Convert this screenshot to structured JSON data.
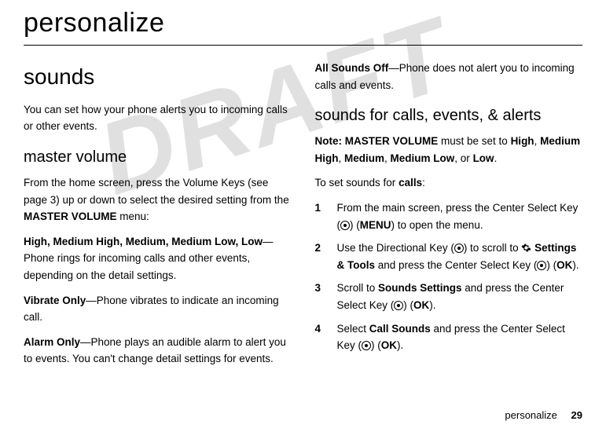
{
  "watermark": "DRAFT",
  "chapter_title": "personalize",
  "left": {
    "section_title": "sounds",
    "intro": "You can set how your phone alerts you to incoming calls or other events.",
    "sub1_title": "master volume",
    "sub1_p1_a": "From the home screen, press the Volume Keys (see page 3) up or down to select the desired setting from the ",
    "sub1_p1_b": "MASTER VOLUME",
    "sub1_p1_c": " menu:",
    "levels_list": "High, Medium High, Medium, Medium Low, Low",
    "levels_suffix": "—Phone rings for incoming calls and other events, depending on the detail settings.",
    "vibrate_label": "Vibrate Only",
    "vibrate_text": "—Phone vibrates to indicate an incoming call.",
    "alarm_label": "Alarm Only",
    "alarm_text": "—Phone plays an audible alarm to alert you to events. You can't change detail settings for events."
  },
  "right": {
    "allsounds_label": "All Sounds Off",
    "allsounds_text": "—Phone does not alert you to incoming calls and events.",
    "sub2_title": "sounds for calls, events, & alerts",
    "note_label": "Note: ",
    "note_b1": "MASTER VOLUME",
    "note_mid": " must be set to ",
    "opt_high": "High",
    "opt_medhigh": "Medium High",
    "opt_med": "Medium",
    "opt_medlow": "Medium Low",
    "opt_low": "Low",
    "note_or": ", or ",
    "note_end": ".",
    "toset_a": "To set sounds for ",
    "toset_b": "calls",
    "toset_c": ":",
    "s1_num": "1",
    "s1_a": "From the main screen, press the Center Select Key (",
    "s1_b": ") (",
    "s1_menu": "MENU",
    "s1_c": ") to open the menu.",
    "s2_num": "2",
    "s2_a": "Use the Directional Key (",
    "s2_b": ") to scroll to ",
    "s2_settings": "Settings & Tools",
    "s2_c": " and press the Center Select Key (",
    "s2_d": ") (",
    "s2_ok": "OK",
    "s2_e": ").",
    "s3_num": "3",
    "s3_a": "Scroll to ",
    "s3_sounds": "Sounds Settings",
    "s3_b": " and press the Center Select Key (",
    "s3_c": ") (",
    "s3_ok": "OK",
    "s3_d": ").",
    "s4_num": "4",
    "s4_a": "Select ",
    "s4_call": "Call Sounds",
    "s4_b": " and press the Center Select Key (",
    "s4_c": ") (",
    "s4_ok": "OK",
    "s4_d": ")."
  },
  "footer_section": "personalize",
  "footer_page": "29"
}
